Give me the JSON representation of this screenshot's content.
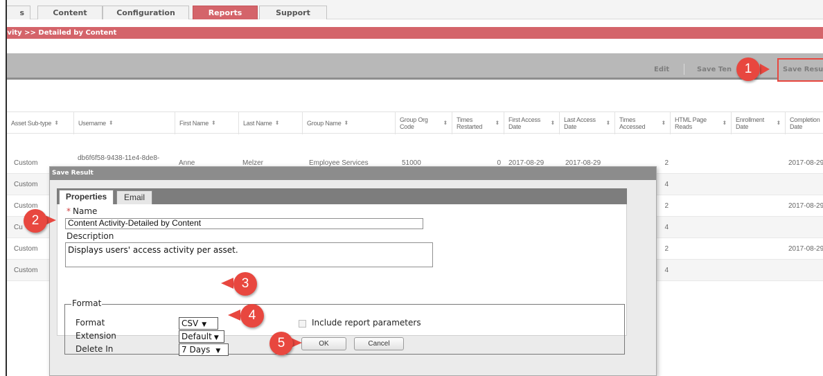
{
  "nav": {
    "tabs": [
      {
        "label": "s"
      },
      {
        "label": "Content"
      },
      {
        "label": "Configuration"
      },
      {
        "label": "Reports",
        "active": true
      },
      {
        "label": "Support"
      }
    ]
  },
  "breadcrumb": "ivity >> Detailed by Content",
  "toolbar": {
    "edit": "Edit",
    "save_template": "Save Ten",
    "save_results": "Save Resu"
  },
  "grid": {
    "columns": [
      "Asset Sub-type",
      "Username",
      "First Name",
      "Last Name",
      "Group Name",
      "Group Org Code",
      "Times Restarted",
      "First Access Date",
      "Last Access Date",
      "Times Accessed",
      "HTML Page Reads",
      "Enrollment Date",
      "Completion Date"
    ],
    "rows": [
      {
        "subtype": "Custom",
        "username": "db6f6f58-9438-11e4-8de8-",
        "first": "Anne",
        "last": "Melzer",
        "group": "Employee Services",
        "org": "51000",
        "restarted": "0",
        "first_access": "2017-08-29",
        "last_access": "2017-08-29",
        "reads": "2",
        "completion": "2017-08-29"
      },
      {
        "subtype": "Custom",
        "reads": "4",
        "completion": ""
      },
      {
        "subtype": "Custom",
        "reads": "2",
        "completion": "2017-08-29"
      },
      {
        "subtype": "Cu",
        "reads": "4",
        "completion": ""
      },
      {
        "subtype": "Custom",
        "reads": "2",
        "completion": "2017-08-29"
      },
      {
        "subtype": "Custom",
        "reads": "4",
        "completion": ""
      }
    ]
  },
  "dialog": {
    "title": "Save Result",
    "tabs": [
      "Properties",
      "Email"
    ],
    "name_required_mark": "*",
    "name_label": "Name",
    "name_value": "Content Activity-Detailed by Content",
    "description_label": "Description",
    "description_value": "Displays users' access activity per asset.",
    "format_legend": "Format",
    "format_label": "Format",
    "format_value": "CSV",
    "extension_label": "Extension",
    "extension_value": "Default",
    "delete_in_label": "Delete In",
    "delete_in_value": "7 Days",
    "include_params_label": "Include report parameters",
    "ok_label": "OK",
    "cancel_label": "Cancel",
    "dropdown_arrow": "▼"
  },
  "callouts": [
    "1",
    "2",
    "3",
    "4",
    "5"
  ],
  "colors": {
    "accent": "#d4646a",
    "callout": "#e8473f",
    "toolbar": "#b8b8b8",
    "dialog_title": "#8c8c8c"
  }
}
